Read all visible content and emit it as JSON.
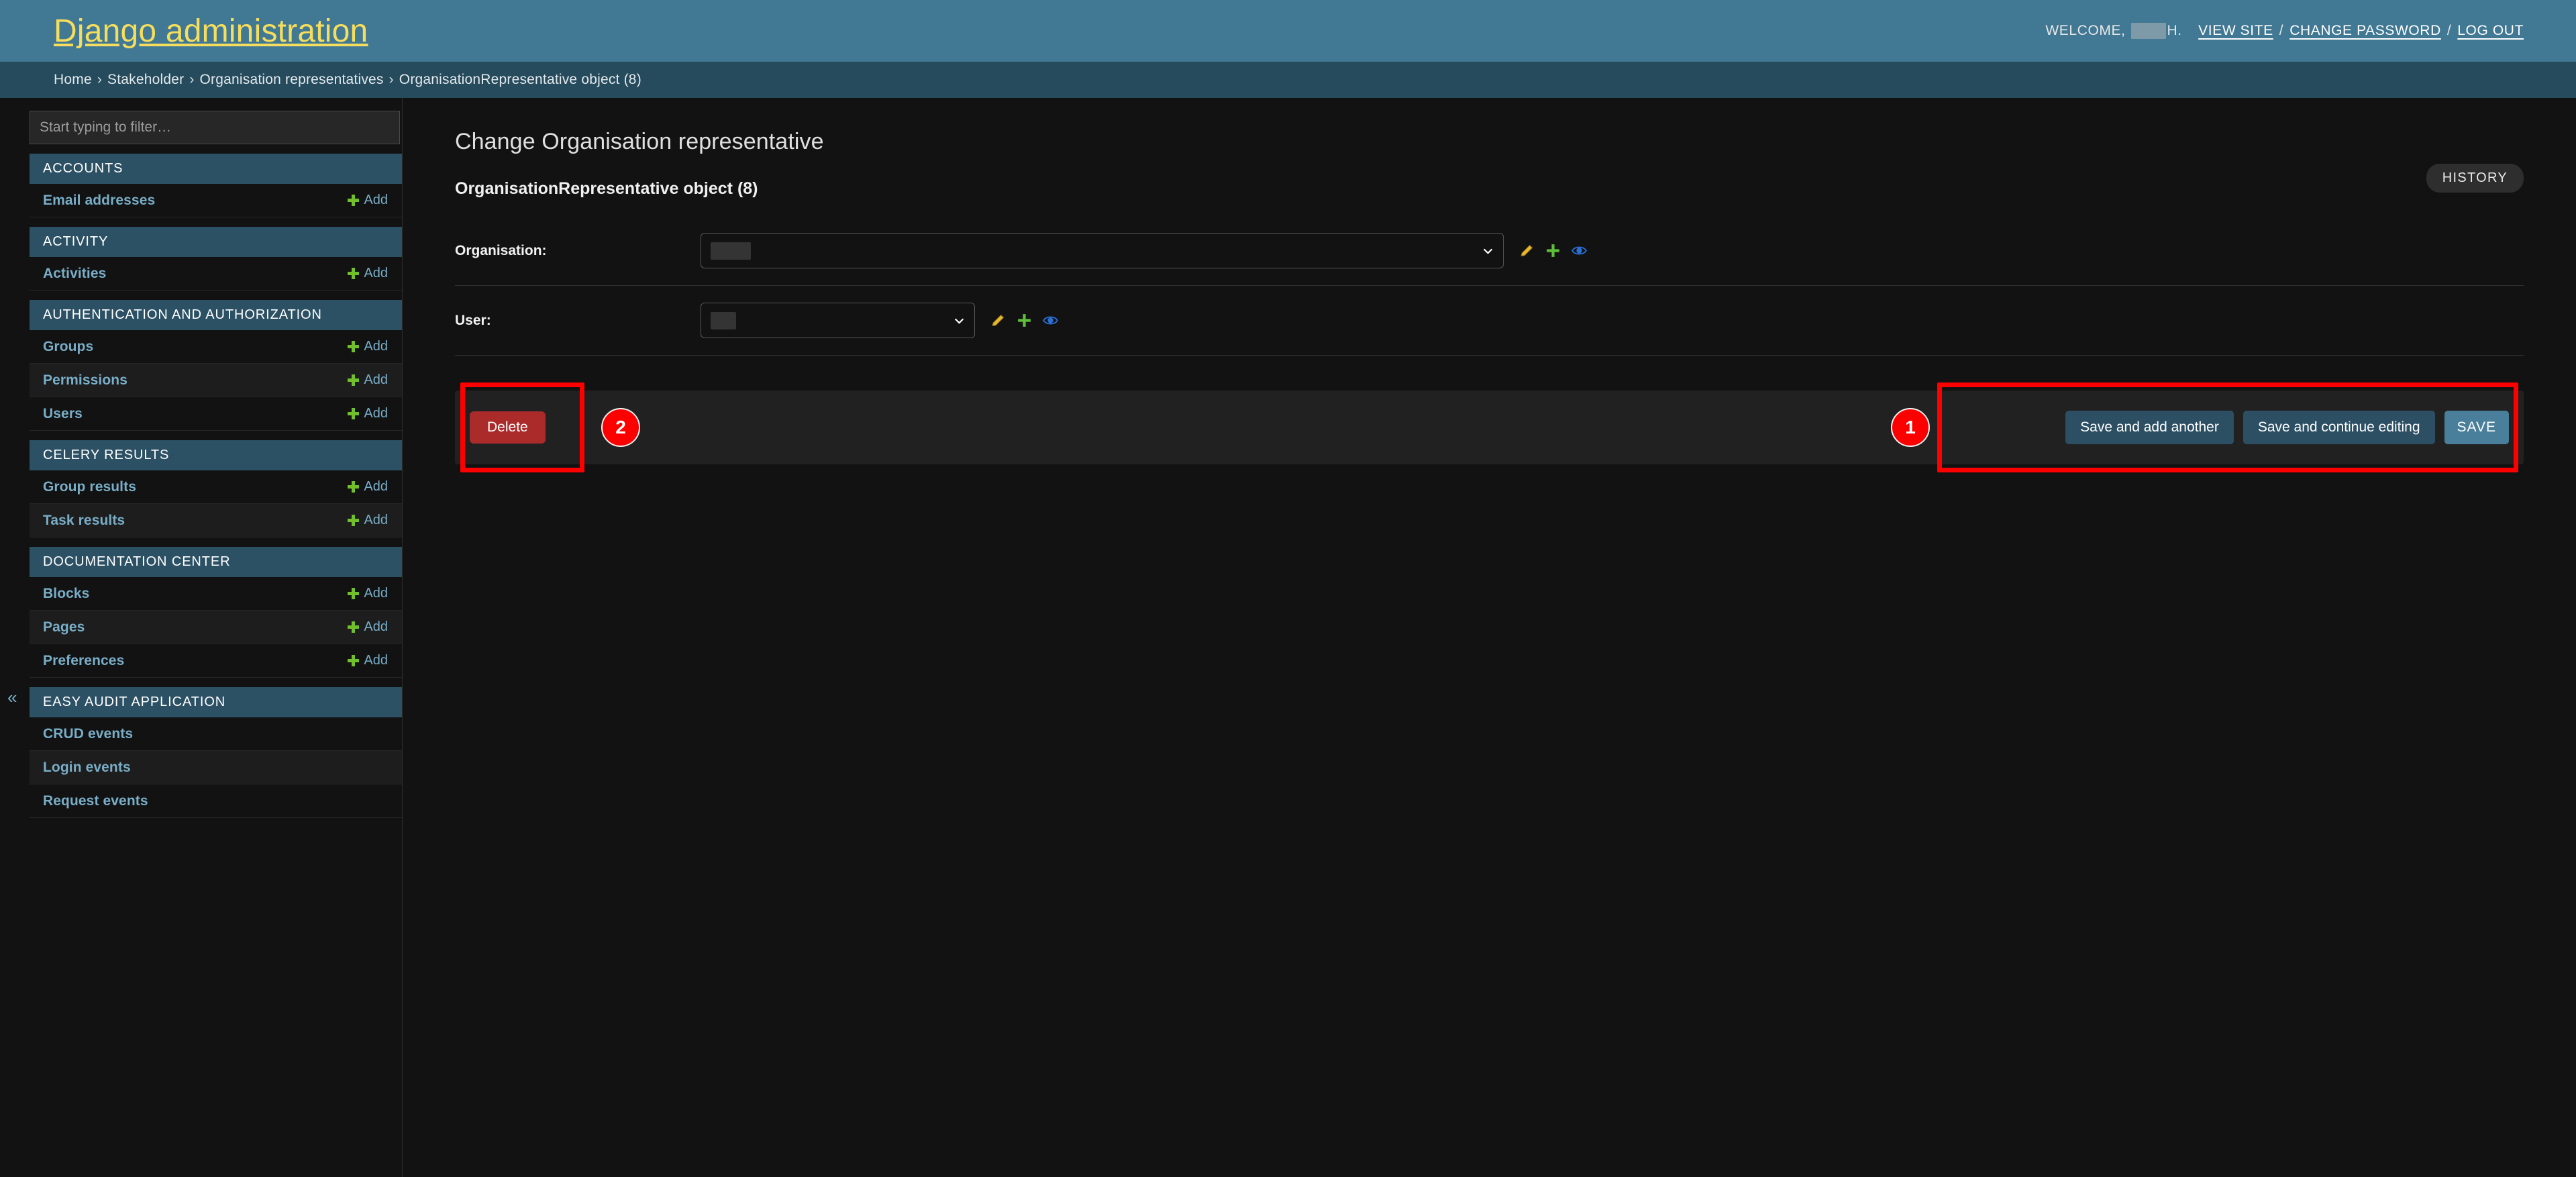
{
  "header": {
    "site_title": "Django administration",
    "welcome_prefix": "WELCOME,",
    "username_suffix": "H.",
    "view_site": "VIEW SITE",
    "change_password": "CHANGE PASSWORD",
    "log_out": "LOG OUT",
    "separator": "/",
    "brand_color": "#417893",
    "title_color": "#f5dd5d"
  },
  "breadcrumbs": {
    "separator": "›",
    "items": [
      {
        "label": "Home"
      },
      {
        "label": "Stakeholder"
      },
      {
        "label": "Organisation representatives"
      },
      {
        "label": "OrganisationRepresentative object (8)"
      }
    ]
  },
  "sidebar": {
    "filter_placeholder": "Start typing to filter…",
    "filter_value": "",
    "collapse_icon": "«",
    "add_label": "Add",
    "apps": [
      {
        "caption": "ACCOUNTS",
        "models": [
          {
            "label": "Email addresses",
            "has_add": true
          }
        ]
      },
      {
        "caption": "ACTIVITY",
        "models": [
          {
            "label": "Activities",
            "has_add": true
          }
        ]
      },
      {
        "caption": "AUTHENTICATION AND AUTHORIZATION",
        "models": [
          {
            "label": "Groups",
            "has_add": true
          },
          {
            "label": "Permissions",
            "has_add": true
          },
          {
            "label": "Users",
            "has_add": true
          }
        ]
      },
      {
        "caption": "CELERY RESULTS",
        "models": [
          {
            "label": "Group results",
            "has_add": true
          },
          {
            "label": "Task results",
            "has_add": true
          }
        ]
      },
      {
        "caption": "DOCUMENTATION CENTER",
        "models": [
          {
            "label": "Blocks",
            "has_add": true
          },
          {
            "label": "Pages",
            "has_add": true
          },
          {
            "label": "Preferences",
            "has_add": true
          }
        ]
      },
      {
        "caption": "EASY AUDIT APPLICATION",
        "models": [
          {
            "label": "CRUD events",
            "has_add": false
          },
          {
            "label": "Login events",
            "has_add": false
          },
          {
            "label": "Request events",
            "has_add": false
          }
        ]
      }
    ]
  },
  "main": {
    "page_title": "Change Organisation representative",
    "history_label": "HISTORY",
    "object_caption": "OrganisationRepresentative object (8)",
    "fields": [
      {
        "label": "Organisation:",
        "value": "",
        "redacted": true,
        "icons": [
          "pencil-icon",
          "plus-icon",
          "eye-icon"
        ]
      },
      {
        "label": "User:",
        "value": "",
        "redacted": true,
        "icons": [
          "pencil-icon",
          "plus-icon",
          "eye-icon"
        ]
      }
    ]
  },
  "submit_row": {
    "delete_label": "Delete",
    "save_add_another_label": "Save and add another",
    "save_continue_label": "Save and continue editing",
    "save_label": "SAVE"
  },
  "annotations": {
    "badge_1": "1",
    "badge_2": "2",
    "color": "#ff0000"
  }
}
